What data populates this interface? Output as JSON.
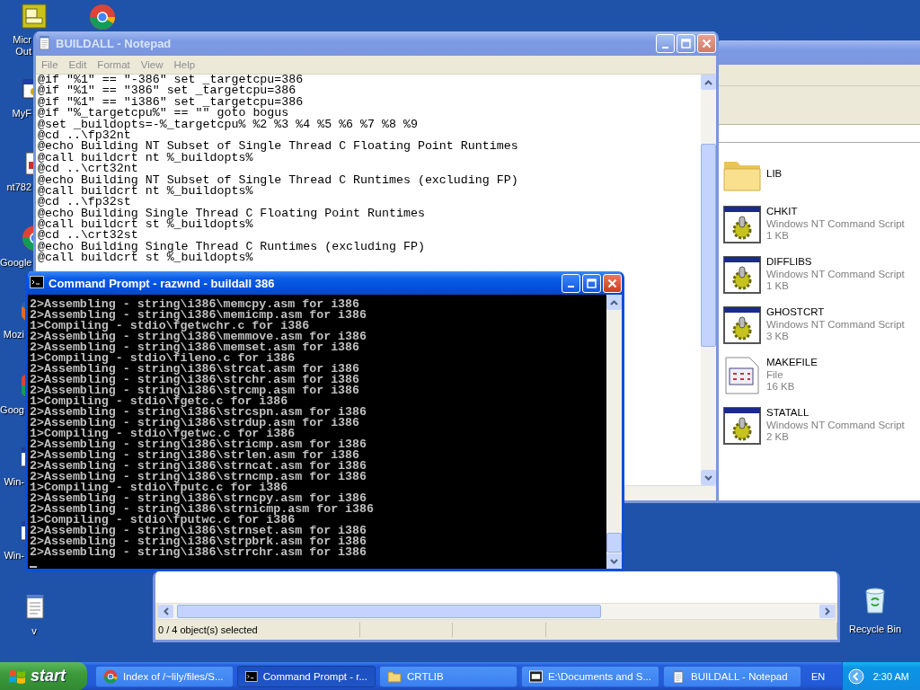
{
  "desktop_icons": [
    {
      "kind": "outlook",
      "label": "Micr\nOut"
    },
    {
      "kind": "program",
      "label": "MyF"
    },
    {
      "kind": "document",
      "label": "nt782"
    },
    {
      "kind": "chrome",
      "label": "Google"
    },
    {
      "kind": "firefox",
      "label": "Mozi"
    },
    {
      "kind": "chrome",
      "label": "Goog"
    },
    {
      "kind": "program",
      "label": "Win-"
    },
    {
      "kind": "program",
      "label": "Win-"
    },
    {
      "kind": "notepad",
      "label": "v"
    },
    {
      "kind": "chrome"
    }
  ],
  "recycle_bin": {
    "label": "Recycle Bin"
  },
  "explorer": {
    "files": [
      {
        "kind": "folder",
        "name": "LIB"
      },
      {
        "kind": "script",
        "name": "CHKIT",
        "type": "Windows NT Command Script",
        "size": "1 KB"
      },
      {
        "kind": "script",
        "name": "DIFFLIBS",
        "type": "Windows NT Command Script",
        "size": "1 KB"
      },
      {
        "kind": "script",
        "name": "GHOSTCRT",
        "type": "Windows NT Command Script",
        "size": "3 KB"
      },
      {
        "kind": "file",
        "name": "MAKEFILE",
        "type": "File",
        "size": "16 KB"
      },
      {
        "kind": "script",
        "name": "STATALL",
        "type": "Windows NT Command Script",
        "size": "2 KB"
      }
    ]
  },
  "archive_window": {
    "status_bar": "0 / 4 object(s) selected"
  },
  "notepad": {
    "title": "BUILDALL - Notepad",
    "active": false,
    "menu": [
      "File",
      "Edit",
      "Format",
      "View",
      "Help"
    ],
    "lines": [
      "@if \"%1\" == \"-386\" set _targetcpu=386",
      "@if \"%1\" == \"386\" set _targetcpu=386",
      "@if \"%1\" == \"i386\" set _targetcpu=386",
      "@if \"%_targetcpu%\" == \"\" goto bogus",
      "@set _buildopts=-%_targetcpu% %2 %3 %4 %5 %6 %7 %8 %9",
      "@cd ..\\fp32nt",
      "@echo Building NT Subset of Single Thread C Floating Point Runtimes",
      "@call buildcrt nt %_buildopts%",
      "@cd ..\\crt32nt",
      "@echo Building NT Subset of Single Thread C Runtimes (excluding FP)",
      "@call buildcrt nt %_buildopts%",
      "@cd ..\\fp32st",
      "@echo Building Single Thread C Floating Point Runtimes",
      "@call buildcrt st %_buildopts%",
      "@cd ..\\crt32st",
      "@echo Building Single Thread C Runtimes (excluding FP)",
      "@call buildcrt st %_buildopts%"
    ]
  },
  "command_prompt": {
    "title": "Command Prompt - razwnd - buildall 386",
    "active": true,
    "lines": [
      "2>Assembling - string\\i386\\memcpy.asm for i386",
      "2>Assembling - string\\i386\\memicmp.asm for i386",
      "1>Compiling - stdio\\fgetwchr.c for i386",
      "2>Assembling - string\\i386\\memmove.asm for i386",
      "2>Assembling - string\\i386\\memset.asm for i386",
      "1>Compiling - stdio\\fileno.c for i386",
      "2>Assembling - string\\i386\\strcat.asm for i386",
      "2>Assembling - string\\i386\\strchr.asm for i386",
      "2>Assembling - string\\i386\\strcmp.asm for i386",
      "1>Compiling - stdio\\fgetc.c for i386",
      "2>Assembling - string\\i386\\strcspn.asm for i386",
      "2>Assembling - string\\i386\\strdup.asm for i386",
      "1>Compiling - stdio\\fgetwc.c for i386",
      "2>Assembling - string\\i386\\stricmp.asm for i386",
      "2>Assembling - string\\i386\\strlen.asm for i386",
      "2>Assembling - string\\i386\\strncat.asm for i386",
      "2>Assembling - string\\i386\\strncmp.asm for i386",
      "1>Compiling - stdio\\fputc.c for i386",
      "2>Assembling - string\\i386\\strncpy.asm for i386",
      "2>Assembling - string\\i386\\strnicmp.asm for i386",
      "1>Compiling - stdio\\fputwc.c for i386",
      "2>Assembling - string\\i386\\strnset.asm for i386",
      "2>Assembling - string\\i386\\strpbrk.asm for i386",
      "2>Assembling - string\\i386\\strrchr.asm for i386"
    ]
  },
  "taskbar": {
    "start": "start",
    "tasks": [
      {
        "kind": "chrome",
        "label": "Index of /~lily/files/S...",
        "selected": false
      },
      {
        "kind": "console",
        "label": "Command Prompt - r...",
        "selected": true
      },
      {
        "kind": "folder",
        "label": "CRTLIB",
        "selected": false
      },
      {
        "kind": "archive",
        "label": "E:\\Documents and S...",
        "selected": false
      },
      {
        "kind": "notepad",
        "label": "BUILDALL - Notepad",
        "selected": false
      }
    ],
    "language": "EN",
    "clock": "2:30 AM"
  }
}
